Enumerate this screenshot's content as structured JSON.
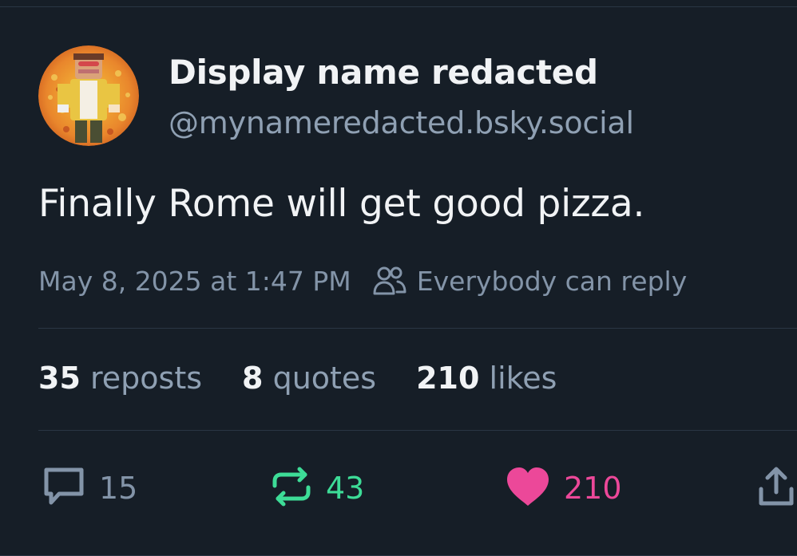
{
  "post": {
    "author_name": "Display name redacted",
    "author_handle": "@mynameredacted.bsky.social",
    "text": "Finally Rome will get good pizza.",
    "timestamp": "May 8, 2025 at 1:47 PM",
    "reply_setting": "Everybody can reply"
  },
  "stats": {
    "reposts_count": "35",
    "reposts_label": "reposts",
    "quotes_count": "8",
    "quotes_label": "quotes",
    "likes_count": "210",
    "likes_label": "likes"
  },
  "actions": {
    "reply_count": "15",
    "repost_count": "43",
    "like_count": "210"
  },
  "colors": {
    "background": "#161e27",
    "text_primary": "#f1f3f5",
    "text_secondary": "#8fa0b3",
    "repost_green": "#3ddc97",
    "like_pink": "#ec4899",
    "icon_gray": "#8394a8"
  },
  "icons": {
    "reply": "speech-bubble-icon",
    "repost": "repost-arrows-icon",
    "like": "heart-icon",
    "share": "share-upload-icon",
    "reply_setting": "people-icon"
  }
}
